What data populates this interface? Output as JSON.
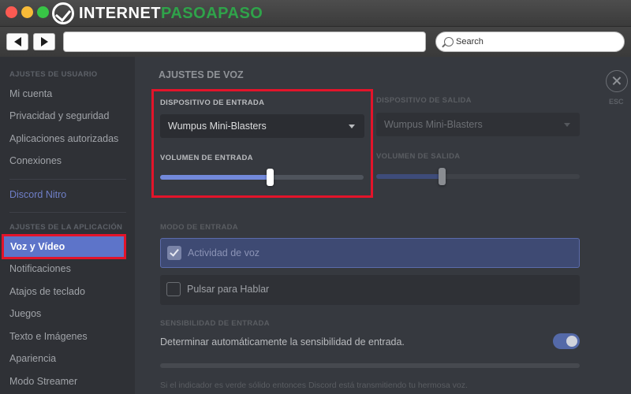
{
  "window": {
    "logo_prefix": "INTERNET",
    "logo_accent": "PASOAPASO"
  },
  "toolbar": {
    "search_placeholder": "Search"
  },
  "sidebar": {
    "user_settings_heading": "AJUSTES DE USUARIO",
    "user_items": [
      {
        "label": "Mi cuenta"
      },
      {
        "label": "Privacidad y seguridad"
      },
      {
        "label": "Aplicaciones autorizadas"
      },
      {
        "label": "Conexiones"
      }
    ],
    "nitro_label": "Discord Nitro",
    "app_settings_heading": "AJUSTES DE LA APLICACIÓN",
    "app_items": [
      {
        "label": "Voz y Vídeo",
        "selected": true
      },
      {
        "label": "Notificaciones"
      },
      {
        "label": "Atajos de teclado"
      },
      {
        "label": "Juegos"
      },
      {
        "label": "Texto e Imágenes"
      },
      {
        "label": "Apariencia"
      },
      {
        "label": "Modo Streamer"
      }
    ]
  },
  "main": {
    "title": "AJUSTES DE VOZ",
    "input_device_label": "DISPOSITIVO DE ENTRADA",
    "input_device_value": "Wumpus Mini-Blasters",
    "output_device_label": "DISPOSITIVO DE SALIDA",
    "output_device_value": "Wumpus Mini-Blasters",
    "input_volume_label": "VOLUMEN DE ENTRADA",
    "input_volume_level": 0.54,
    "output_volume_label": "VOLUMEN DE SALIDA",
    "output_volume_level": 0.32,
    "input_mode_label": "MODO DE ENTRADA",
    "mode_voice_label": "Actividad de voz",
    "mode_voice_checked": true,
    "mode_ptt_label": "Pulsar para Hablar",
    "mode_ptt_checked": false,
    "sensitivity_label": "SENSIBILIDAD DE ENTRADA",
    "auto_sensitivity_text": "Determinar automáticamente la sensibilidad de entrada.",
    "auto_sensitivity_on": true,
    "footnote": "Si el indicador es verde sólido entonces Discord está transmitiendo tu hermosa voz.",
    "esc_label": "ESC"
  },
  "colors": {
    "accent": "#7289da",
    "highlight": "#e3142a",
    "selected_item": "#5d74c9"
  }
}
